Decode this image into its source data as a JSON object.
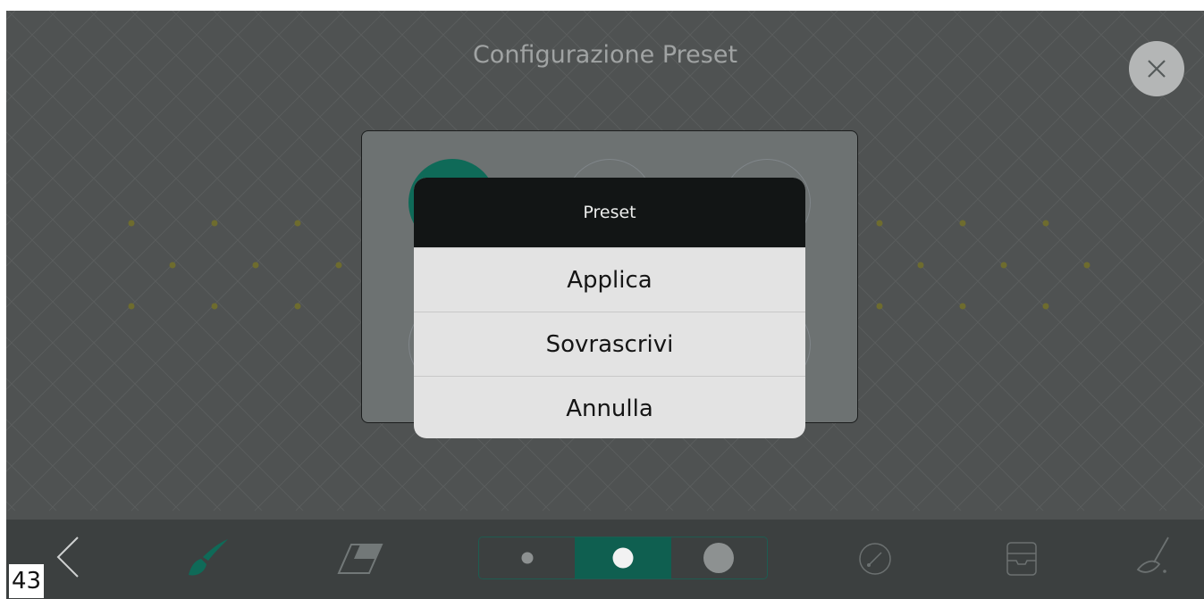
{
  "screen": {
    "title": "Configurazione Preset"
  },
  "close_button": {
    "icon": "close-icon"
  },
  "preset_panel": {
    "slots": [
      {
        "state": "active",
        "color": "#0f6a58"
      },
      {
        "state": "empty"
      },
      {
        "state": "empty"
      },
      {
        "state": "empty"
      },
      {
        "state": "empty"
      },
      {
        "state": "empty"
      }
    ]
  },
  "dialog": {
    "title": "Preset",
    "options": [
      "Applica",
      "Sovrascrivi",
      "Annulla"
    ]
  },
  "toolbar": {
    "back": "chevron-left-icon",
    "brush": {
      "icon": "brush-icon",
      "active": true,
      "color": "#0f6a58"
    },
    "eraser": "eraser-icon",
    "size_options": [
      "small",
      "medium",
      "large"
    ],
    "selected_size": "medium",
    "compass": "compass-icon",
    "tray": "tray-icon",
    "clear": "broom-icon"
  },
  "page_number": "43",
  "colors": {
    "background": "#4f5252",
    "accent": "#0f6a58",
    "pattern_dot": "#6e6c2e"
  }
}
